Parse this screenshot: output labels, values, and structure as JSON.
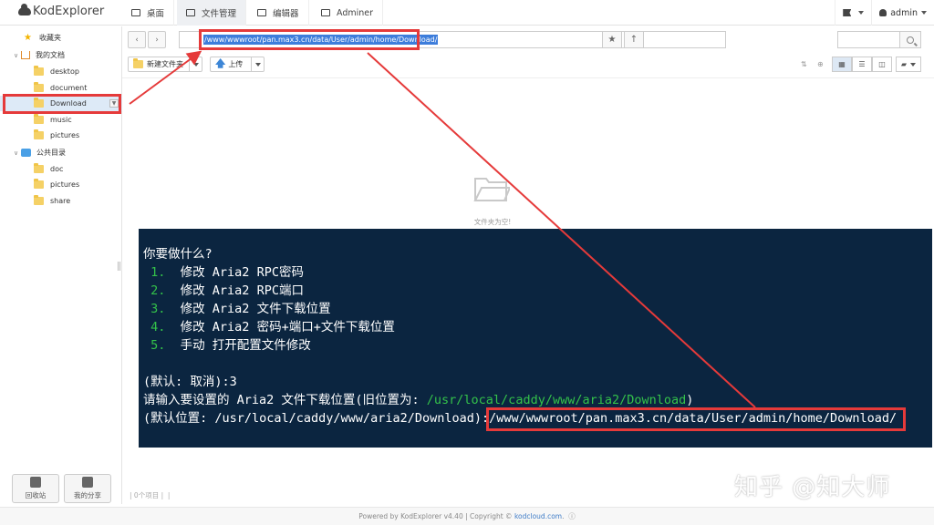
{
  "app": {
    "name": "KodExplorer"
  },
  "topnav": {
    "tabs": [
      {
        "label": "桌面",
        "icon": "desktop-icon"
      },
      {
        "label": "文件管理",
        "icon": "folder-icon"
      },
      {
        "label": "编辑器",
        "icon": "edit-icon"
      },
      {
        "label": "Adminer",
        "icon": "database-icon"
      }
    ],
    "active_tab": "文件管理",
    "user": "admin"
  },
  "sidebar": {
    "items": [
      {
        "label": "收藏夹",
        "icon": "star-icon",
        "level": 0
      },
      {
        "label": "我的文档",
        "icon": "home-icon",
        "level": 0
      },
      {
        "label": "desktop",
        "icon": "folder-icon",
        "level": 1
      },
      {
        "label": "document",
        "icon": "folder-icon",
        "level": 1
      },
      {
        "label": "Download",
        "icon": "folder-icon",
        "level": 1,
        "selected": true
      },
      {
        "label": "music",
        "icon": "folder-icon",
        "level": 1
      },
      {
        "label": "pictures",
        "icon": "folder-icon",
        "level": 1
      },
      {
        "label": "公共目录",
        "icon": "public-icon",
        "level": 0
      },
      {
        "label": "doc",
        "icon": "folder-icon",
        "level": 1
      },
      {
        "label": "pictures",
        "icon": "folder-icon",
        "level": 1
      },
      {
        "label": "share",
        "icon": "folder-icon",
        "level": 1
      }
    ],
    "bottom_buttons": [
      {
        "label": "回收站",
        "icon": "trash-icon"
      },
      {
        "label": "我的分享",
        "icon": "share-icon"
      }
    ]
  },
  "pathbar": {
    "path": "/www/wwwroot/pan.max3.cn/data/User/admin/home/Download/"
  },
  "actions": {
    "new_folder": "新建文件夹",
    "upload": "上传"
  },
  "main": {
    "empty_text": "文件夹为空!"
  },
  "terminal": {
    "prompt": "你要做什么?",
    "options": [
      {
        "num": "1.",
        "text": "修改 Aria2 RPC密码"
      },
      {
        "num": "2.",
        "text": "修改 Aria2 RPC端口"
      },
      {
        "num": "3.",
        "text": "修改 Aria2 文件下载位置"
      },
      {
        "num": "4.",
        "text": "修改 Aria2 密码+端口+文件下载位置"
      },
      {
        "num": "5.",
        "text": "手动 打开配置文件修改"
      }
    ],
    "default_line": "(默认: 取消):3",
    "input_prefix": "请输入要设置的 Aria2 文件下载位置(旧位置为: ",
    "old_path": "/usr/local/caddy/www/aria2/Download",
    "input_suffix": ")",
    "default_location": "(默认位置: /usr/local/caddy/www/aria2/Download):",
    "entered_path": "/www/wwwroot/pan.max3.cn/data/User/admin/home/Download/"
  },
  "status": {
    "count": "0个项目"
  },
  "footer": {
    "prefix": "Powered by KodExplorer v4.40 | Copyright © ",
    "link": "kodcloud.com",
    "suffix": "."
  },
  "watermark": "知乎 @知大师",
  "colors": {
    "terminal_bg": "#0b2540",
    "terminal_green": "#34c24a",
    "annotation_red": "#e53a3a",
    "selection_blue": "#3d7ddb"
  }
}
